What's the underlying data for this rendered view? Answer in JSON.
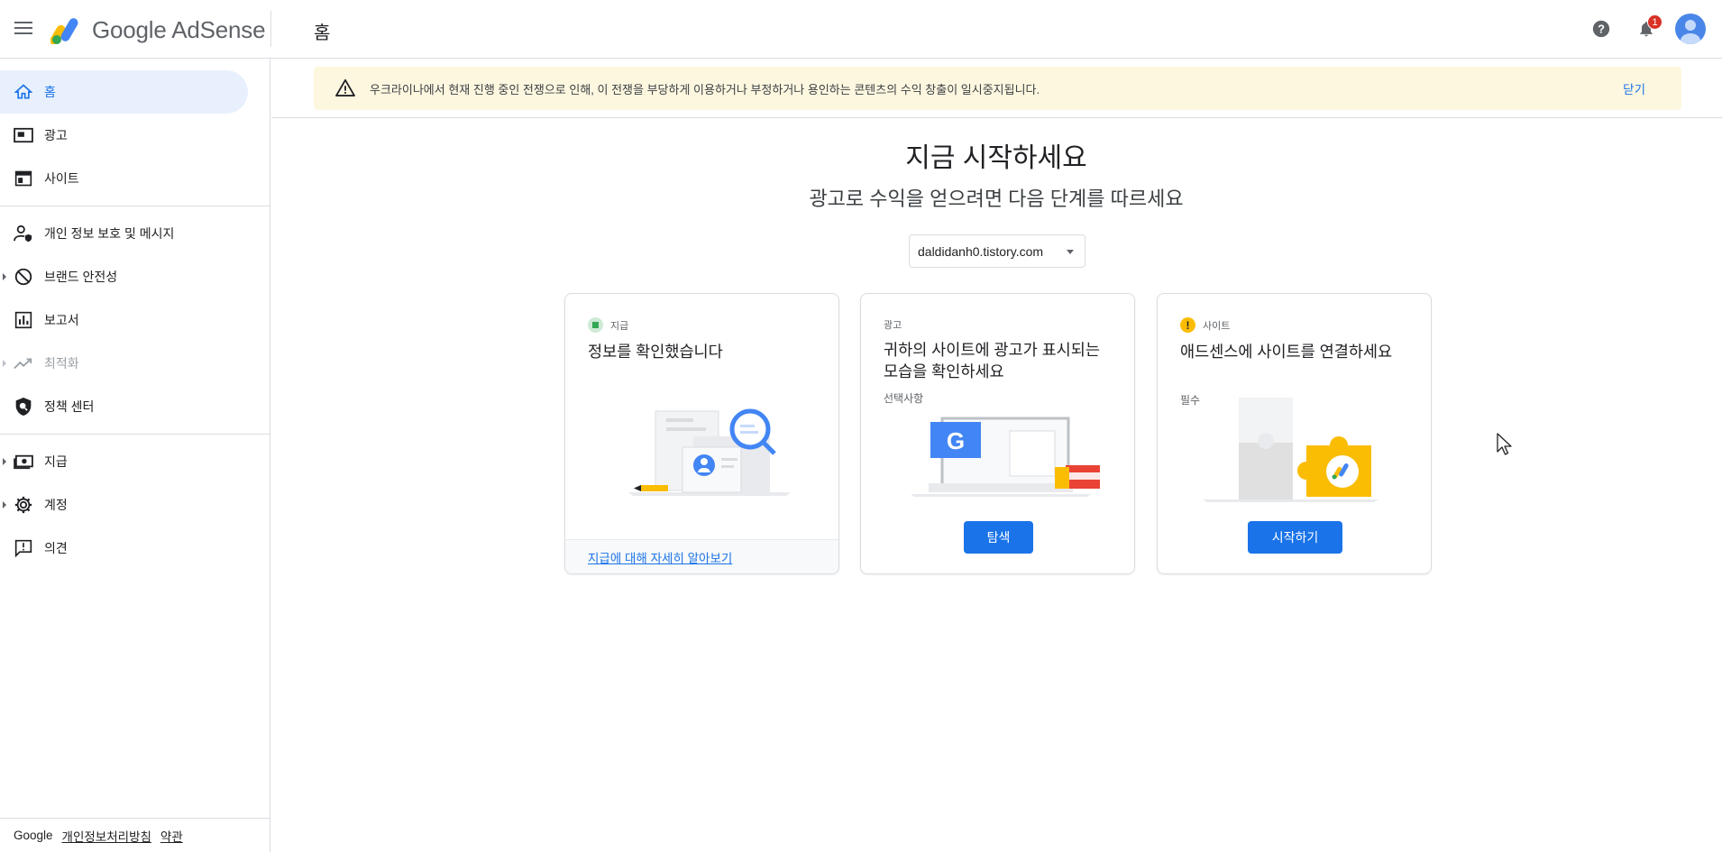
{
  "app": {
    "brand": "Google AdSense",
    "page_title": "홈"
  },
  "header": {
    "notification_count": "1"
  },
  "sidebar": {
    "items": [
      {
        "label": "홈",
        "icon": "home-icon"
      },
      {
        "label": "광고",
        "icon": "ads-icon"
      },
      {
        "label": "사이트",
        "icon": "sites-icon"
      },
      {
        "label": "개인 정보 보호 및 메시지",
        "icon": "privacy-icon"
      },
      {
        "label": "브랜드 안전성",
        "icon": "block-icon"
      },
      {
        "label": "보고서",
        "icon": "reports-icon"
      },
      {
        "label": "최적화",
        "icon": "trending-icon"
      },
      {
        "label": "정책 센터",
        "icon": "policy-icon"
      },
      {
        "label": "지급",
        "icon": "payments-icon"
      },
      {
        "label": "계정",
        "icon": "gear-icon"
      },
      {
        "label": "의견",
        "icon": "feedback-icon"
      }
    ],
    "footer": {
      "google": "Google",
      "privacy": "개인정보처리방침",
      "terms": "약관"
    }
  },
  "banner": {
    "message": "우크라이나에서 현재 진행 중인 전쟁으로 인해, 이 전쟁을 부당하게 이용하거나 부정하거나 용인하는 콘텐츠의 수익 창출이 일시중지됩니다.",
    "close": "닫기"
  },
  "main": {
    "title": "지금 시작하세요",
    "subtitle": "광고로 수익을 얻으려면 다음 단계를 따르세요",
    "site_selector": "daldidanh0.tistory.com"
  },
  "cards": [
    {
      "tag": "지급",
      "title": "정보를 확인했습니다",
      "link": "지급에 대해 자세히 알아보기",
      "status_color": "#34a853"
    },
    {
      "tag": "광고",
      "title": "귀하의 사이트에 광고가 표시되는 모습을 확인하세요",
      "note": "선택사항",
      "button": "탐색"
    },
    {
      "tag": "사이트",
      "title": "애드센스에 사이트를 연결하세요",
      "note": "필수",
      "button": "시작하기",
      "status_color": "#fbbc04"
    }
  ],
  "colors": {
    "accent": "#1a73e8",
    "banner_bg": "#fef7e0",
    "active_nav": "#e8f0fe"
  }
}
